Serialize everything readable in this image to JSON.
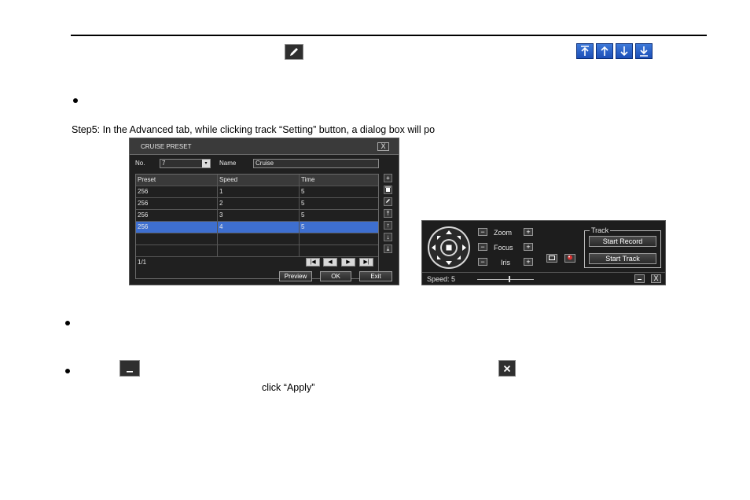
{
  "doc": {
    "step5": "Step5: In the Advanced tab, while clicking track “Setting” button, a dialog box will po",
    "apply_text": "click “Apply”"
  },
  "icons": {
    "edit": "pencil-icon",
    "move_top": "arrow-top-icon",
    "move_up": "arrow-up-icon",
    "move_down": "arrow-down-icon",
    "move_bottom": "arrow-bottom-icon",
    "minimize": "minimize-icon",
    "close": "close-icon"
  },
  "cruise_dialog": {
    "title": "CRUISE PRESET",
    "close": "X",
    "no_label": "No.",
    "no_value": "7",
    "name_label": "Name",
    "name_value": "Cruise",
    "columns": [
      "Preset",
      "Speed",
      "Time"
    ],
    "rows": [
      {
        "preset": "256",
        "speed": "1",
        "time": "5"
      },
      {
        "preset": "256",
        "speed": "2",
        "time": "5"
      },
      {
        "preset": "256",
        "speed": "3",
        "time": "5"
      },
      {
        "preset": "256",
        "speed": "4",
        "time": "5"
      }
    ],
    "selected_row": 3,
    "page": "1/1",
    "buttons": {
      "preview": "Preview",
      "ok": "OK",
      "exit": "Exit"
    }
  },
  "ptz_panel": {
    "zoom": "Zoom",
    "focus": "Focus",
    "iris": "Iris",
    "minus": "−",
    "plus": "+",
    "track_legend": "Track",
    "start_record": "Start Record",
    "start_track": "Start Track",
    "speed": "Speed: 5",
    "speed_level": 5,
    "close": "X"
  },
  "colors": {
    "selected_row": "#3e6fd0",
    "arrow_button": "#2a5fc8",
    "dialog_bg": "#202020"
  }
}
